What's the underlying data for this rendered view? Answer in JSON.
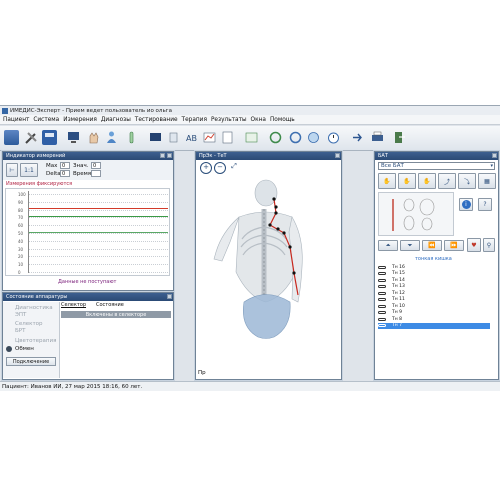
{
  "window": {
    "title": "ИМЕДИС-Эксперт - Прием ведет пользователь ио ольга"
  },
  "menu": [
    "Пациент",
    "Система",
    "Измерения",
    "Диагнозы",
    "Тестирование",
    "Терапия",
    "Результаты",
    "Окна",
    "Помощь"
  ],
  "colors": {
    "titlebar": "#2b4a75",
    "accent_red": "#d23a2a",
    "accent_green": "#3a9a45",
    "selected_row": "#3d8be5"
  },
  "indicator": {
    "title": "Индикатор измерений",
    "ratio": "1:1",
    "max_label": "Max",
    "max_value": "0",
    "delta_label": "Delta",
    "delta_value": "0",
    "znach_label": "Знач.",
    "znach_value": "0",
    "vremya_label": "Время",
    "status": "Измерения фиксируются",
    "y_ticks": [
      "100",
      "90",
      "80",
      "70",
      "60",
      "50",
      "40",
      "30",
      "20",
      "10",
      "0"
    ],
    "no_data": "Данные не поступают"
  },
  "hardware": {
    "title": "Состояние аппаратуры",
    "items": [
      "Диагностика",
      "ЭПТ",
      "Селектор",
      "БРТ",
      "Цветотерапия"
    ],
    "obmen": "Обмен",
    "connect": "Подключение",
    "tabs": [
      "Селектор",
      "Состояние"
    ],
    "selector_status": "Включены в селекторе"
  },
  "body_view": {
    "title": "ПрЭк - ТеТ",
    "footer": "Пр"
  },
  "bat": {
    "title": "БАТ",
    "dropdown": "Все БАТ",
    "group": "тонкая кишка",
    "points": [
      {
        "label": "Тн 16",
        "selected": false
      },
      {
        "label": "Тн 15",
        "selected": false
      },
      {
        "label": "Тн 14",
        "selected": false
      },
      {
        "label": "Тн 13",
        "selected": false
      },
      {
        "label": "Тн 12",
        "selected": false
      },
      {
        "label": "Тн 11",
        "selected": false
      },
      {
        "label": "Тн 10",
        "selected": false
      },
      {
        "label": "Тн 9",
        "selected": false
      },
      {
        "label": "Тн 8",
        "selected": false
      },
      {
        "label": "Тн 7",
        "selected": true
      }
    ]
  },
  "status": {
    "patient": "Пациент: Иванов ИИ, 27 мар 2015 18:16, 60 лет."
  }
}
